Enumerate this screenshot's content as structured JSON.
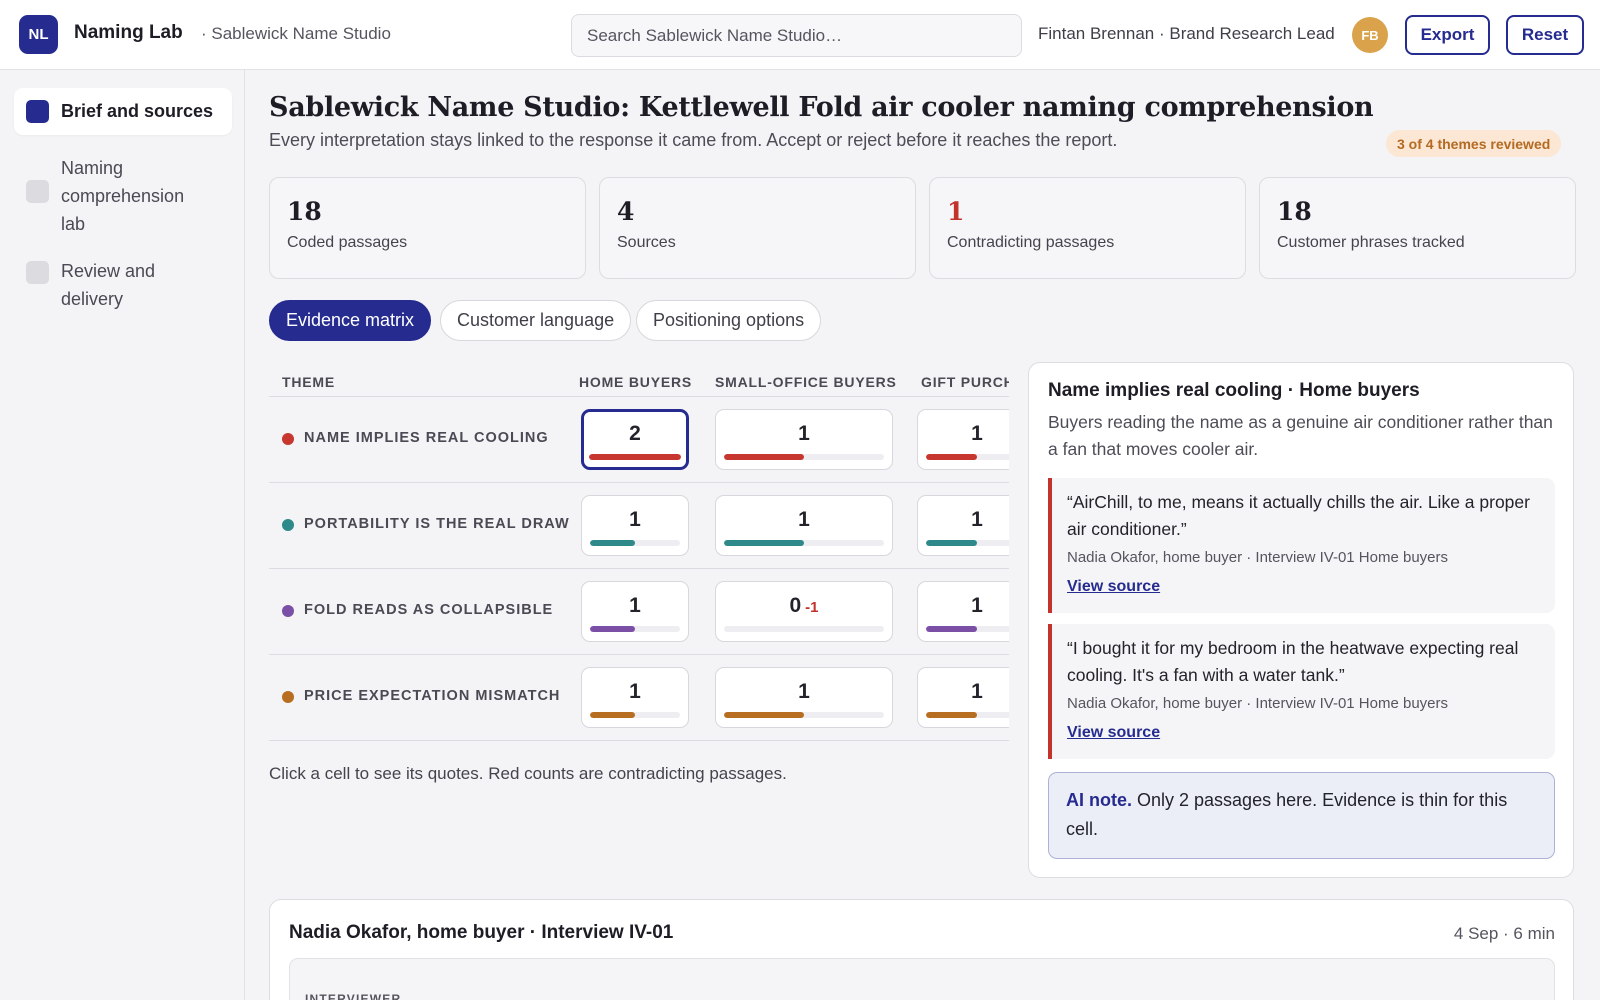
{
  "app": {
    "logo_text": "NL",
    "name": "Naming Lab",
    "workspace": "· Sablewick Name Studio",
    "search_placeholder": "Search Sablewick Name Studio…",
    "user": "Fintan Brennan · Brand Research Lead",
    "avatar_initials": "FB",
    "export_label": "Export",
    "reset_label": "Reset"
  },
  "sidebar": {
    "items": [
      {
        "label": "Brief and sources",
        "active": true
      },
      {
        "label": "Naming comprehension lab",
        "active": false
      },
      {
        "label": "Review and delivery",
        "active": false
      }
    ]
  },
  "header": {
    "title": "Sablewick Name Studio: Kettlewell Fold air cooler naming comprehension",
    "subtitle": "Every interpretation stays linked to the response it came from. Accept or reject before it reaches the report.",
    "review_badge": "3 of 4 themes reviewed"
  },
  "stats": [
    {
      "value": "18",
      "label": "Coded passages"
    },
    {
      "value": "4",
      "label": "Sources"
    },
    {
      "value": "1",
      "label": "Contradicting passages"
    },
    {
      "value": "18",
      "label": "Customer phrases tracked"
    }
  ],
  "tabs": [
    {
      "label": "Evidence matrix",
      "active": true
    },
    {
      "label": "Customer language",
      "active": false
    },
    {
      "label": "Positioning options",
      "active": false
    }
  ],
  "matrix": {
    "headers": {
      "theme": "THEME",
      "segments": [
        "HOME BUYERS",
        "SMALL-OFFICE BUYERS",
        "GIFT PURCHASERS"
      ]
    },
    "rows": [
      {
        "theme": "NAME IMPLIES REAL COOLING",
        "color": "#c8372f",
        "cells": [
          {
            "count": "2",
            "contradict": "",
            "fill": 1.0
          },
          {
            "count": "1",
            "contradict": "",
            "fill": 0.5
          },
          {
            "count": "1",
            "contradict": "",
            "fill": 0.5
          }
        ]
      },
      {
        "theme": "PORTABILITY IS THE REAL DRAW",
        "color": "#2e8a8a",
        "cells": [
          {
            "count": "1",
            "contradict": "",
            "fill": 0.5
          },
          {
            "count": "1",
            "contradict": "",
            "fill": 0.5
          },
          {
            "count": "1",
            "contradict": "",
            "fill": 0.5
          }
        ]
      },
      {
        "theme": "FOLD READS AS COLLAPSIBLE",
        "color": "#7b4fa6",
        "cells": [
          {
            "count": "1",
            "contradict": "",
            "fill": 0.5
          },
          {
            "count": "0",
            "contradict": "-1",
            "fill": 0.0
          },
          {
            "count": "1",
            "contradict": "",
            "fill": 0.5
          }
        ]
      },
      {
        "theme": "PRICE EXPECTATION MISMATCH",
        "color": "#b86e21",
        "cells": [
          {
            "count": "1",
            "contradict": "",
            "fill": 0.5
          },
          {
            "count": "1",
            "contradict": "",
            "fill": 0.5
          },
          {
            "count": "1",
            "contradict": "",
            "fill": 0.5
          }
        ]
      }
    ],
    "hint": "Click a cell to see its quotes. Red counts are contradicting passages."
  },
  "detail": {
    "title": "Name implies real cooling · Home buyers",
    "description": "Buyers reading the name as a genuine air conditioner rather than a fan that moves cooler air.",
    "quotes": [
      {
        "text": "“AirChill, to me, means it actually chills the air. Like a proper air conditioner.”",
        "meta": "Nadia Okafor, home buyer · Interview IV-01  Home buyers",
        "link": "View source"
      },
      {
        "text": "“I bought it for my bedroom in the heatwave expecting real cooling. It's a fan with a water tank.”",
        "meta": "Nadia Okafor, home buyer · Interview IV-01  Home buyers",
        "link": "View source"
      }
    ],
    "ai_note_label": "AI note.",
    "ai_note_text": " Only 2 passages here. Evidence is thin for this cell."
  },
  "transcript": {
    "title": "Nadia Okafor, home buyer · Interview IV-01",
    "meta": "4 Sep · 6 min",
    "speaker": "INTERVIEWER"
  }
}
